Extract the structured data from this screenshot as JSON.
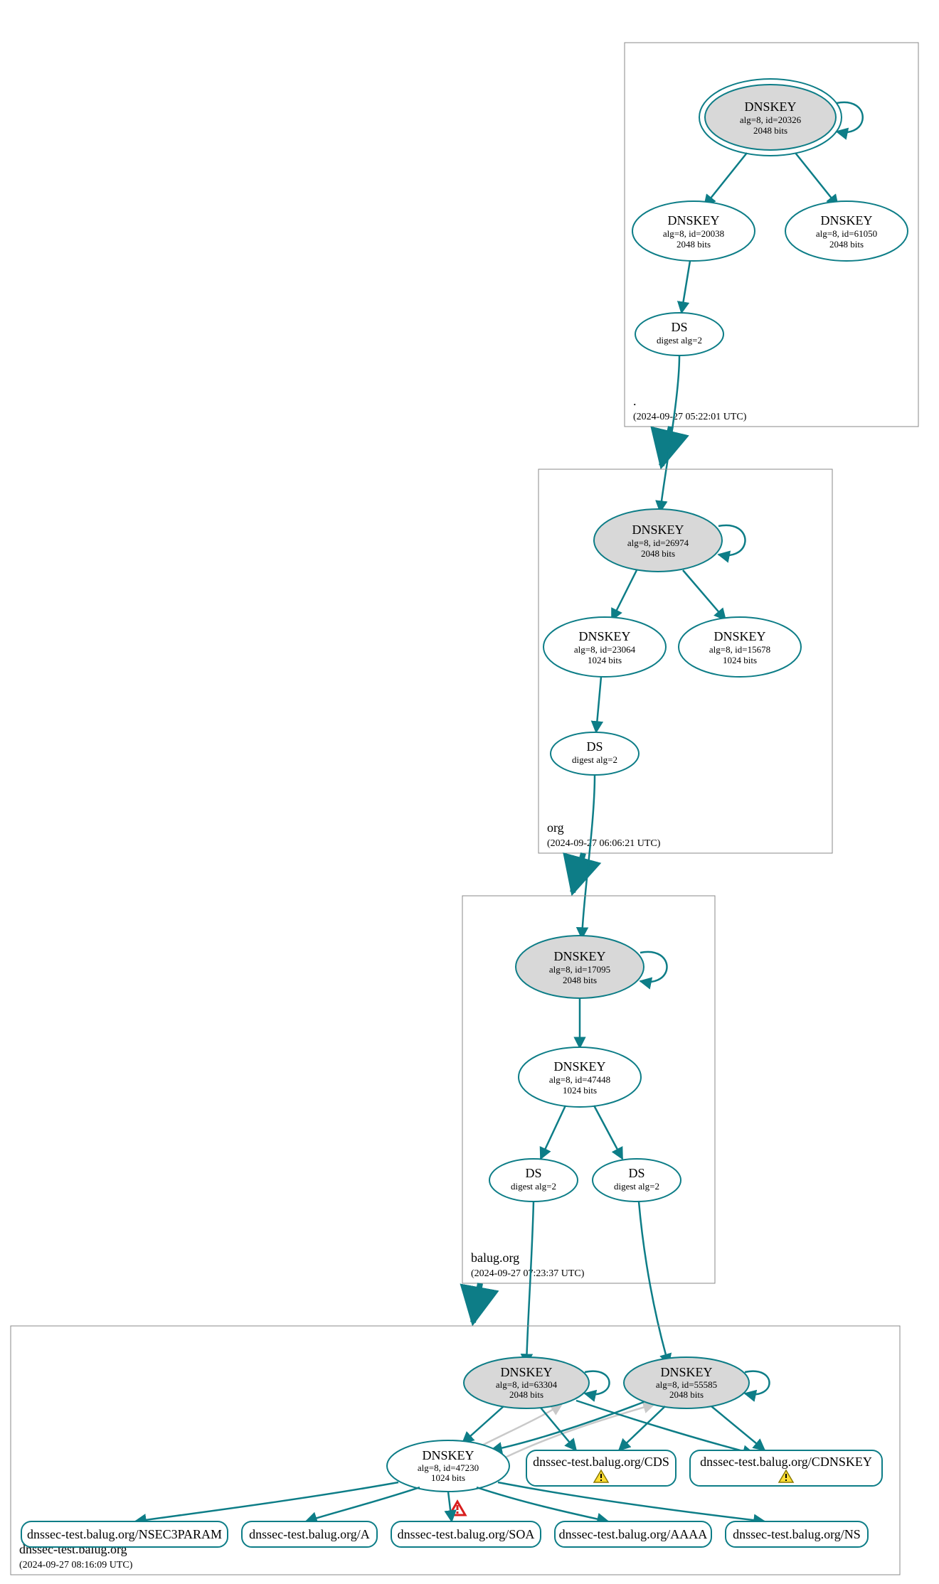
{
  "colors": {
    "teal": "#0d7d87",
    "grey_fill": "#d8d8d8",
    "box_stroke": "#888888",
    "light_edge": "#c9c9c9",
    "warn_fill": "#ffdd33",
    "warn_stroke": "#8a7a00",
    "err_fill": "#d81e1e",
    "err_stroke": "#7a0000"
  },
  "zones": {
    "root": {
      "label": ".",
      "timestamp": "(2024-09-27 05:22:01 UTC)",
      "ksk": {
        "title": "DNSKEY",
        "line1": "alg=8, id=20326",
        "line2": "2048 bits"
      },
      "zsk1": {
        "title": "DNSKEY",
        "line1": "alg=8, id=20038",
        "line2": "2048 bits"
      },
      "zsk2": {
        "title": "DNSKEY",
        "line1": "alg=8, id=61050",
        "line2": "2048 bits"
      },
      "ds": {
        "title": "DS",
        "line1": "digest alg=2"
      }
    },
    "org": {
      "label": "org",
      "timestamp": "(2024-09-27 06:06:21 UTC)",
      "ksk": {
        "title": "DNSKEY",
        "line1": "alg=8, id=26974",
        "line2": "2048 bits"
      },
      "zsk1": {
        "title": "DNSKEY",
        "line1": "alg=8, id=23064",
        "line2": "1024 bits"
      },
      "zsk2": {
        "title": "DNSKEY",
        "line1": "alg=8, id=15678",
        "line2": "1024 bits"
      },
      "ds": {
        "title": "DS",
        "line1": "digest alg=2"
      }
    },
    "balug": {
      "label": "balug.org",
      "timestamp": "(2024-09-27 07:23:37 UTC)",
      "ksk": {
        "title": "DNSKEY",
        "line1": "alg=8, id=17095",
        "line2": "2048 bits"
      },
      "zsk": {
        "title": "DNSKEY",
        "line1": "alg=8, id=47448",
        "line2": "1024 bits"
      },
      "ds1": {
        "title": "DS",
        "line1": "digest alg=2"
      },
      "ds2": {
        "title": "DS",
        "line1": "digest alg=2"
      }
    },
    "test": {
      "label": "dnssec-test.balug.org",
      "timestamp": "(2024-09-27 08:16:09 UTC)",
      "ksk1": {
        "title": "DNSKEY",
        "line1": "alg=8, id=63304",
        "line2": "2048 bits"
      },
      "ksk2": {
        "title": "DNSKEY",
        "line1": "alg=8, id=55585",
        "line2": "2048 bits"
      },
      "zsk": {
        "title": "DNSKEY",
        "line1": "alg=8, id=47230",
        "line2": "1024 bits"
      },
      "rrsets": {
        "cds": "dnssec-test.balug.org/CDS",
        "cdnskey": "dnssec-test.balug.org/CDNSKEY",
        "nsec3": "dnssec-test.balug.org/NSEC3PARAM",
        "a": "dnssec-test.balug.org/A",
        "soa": "dnssec-test.balug.org/SOA",
        "aaaa": "dnssec-test.balug.org/AAAA",
        "ns": "dnssec-test.balug.org/NS"
      }
    }
  }
}
